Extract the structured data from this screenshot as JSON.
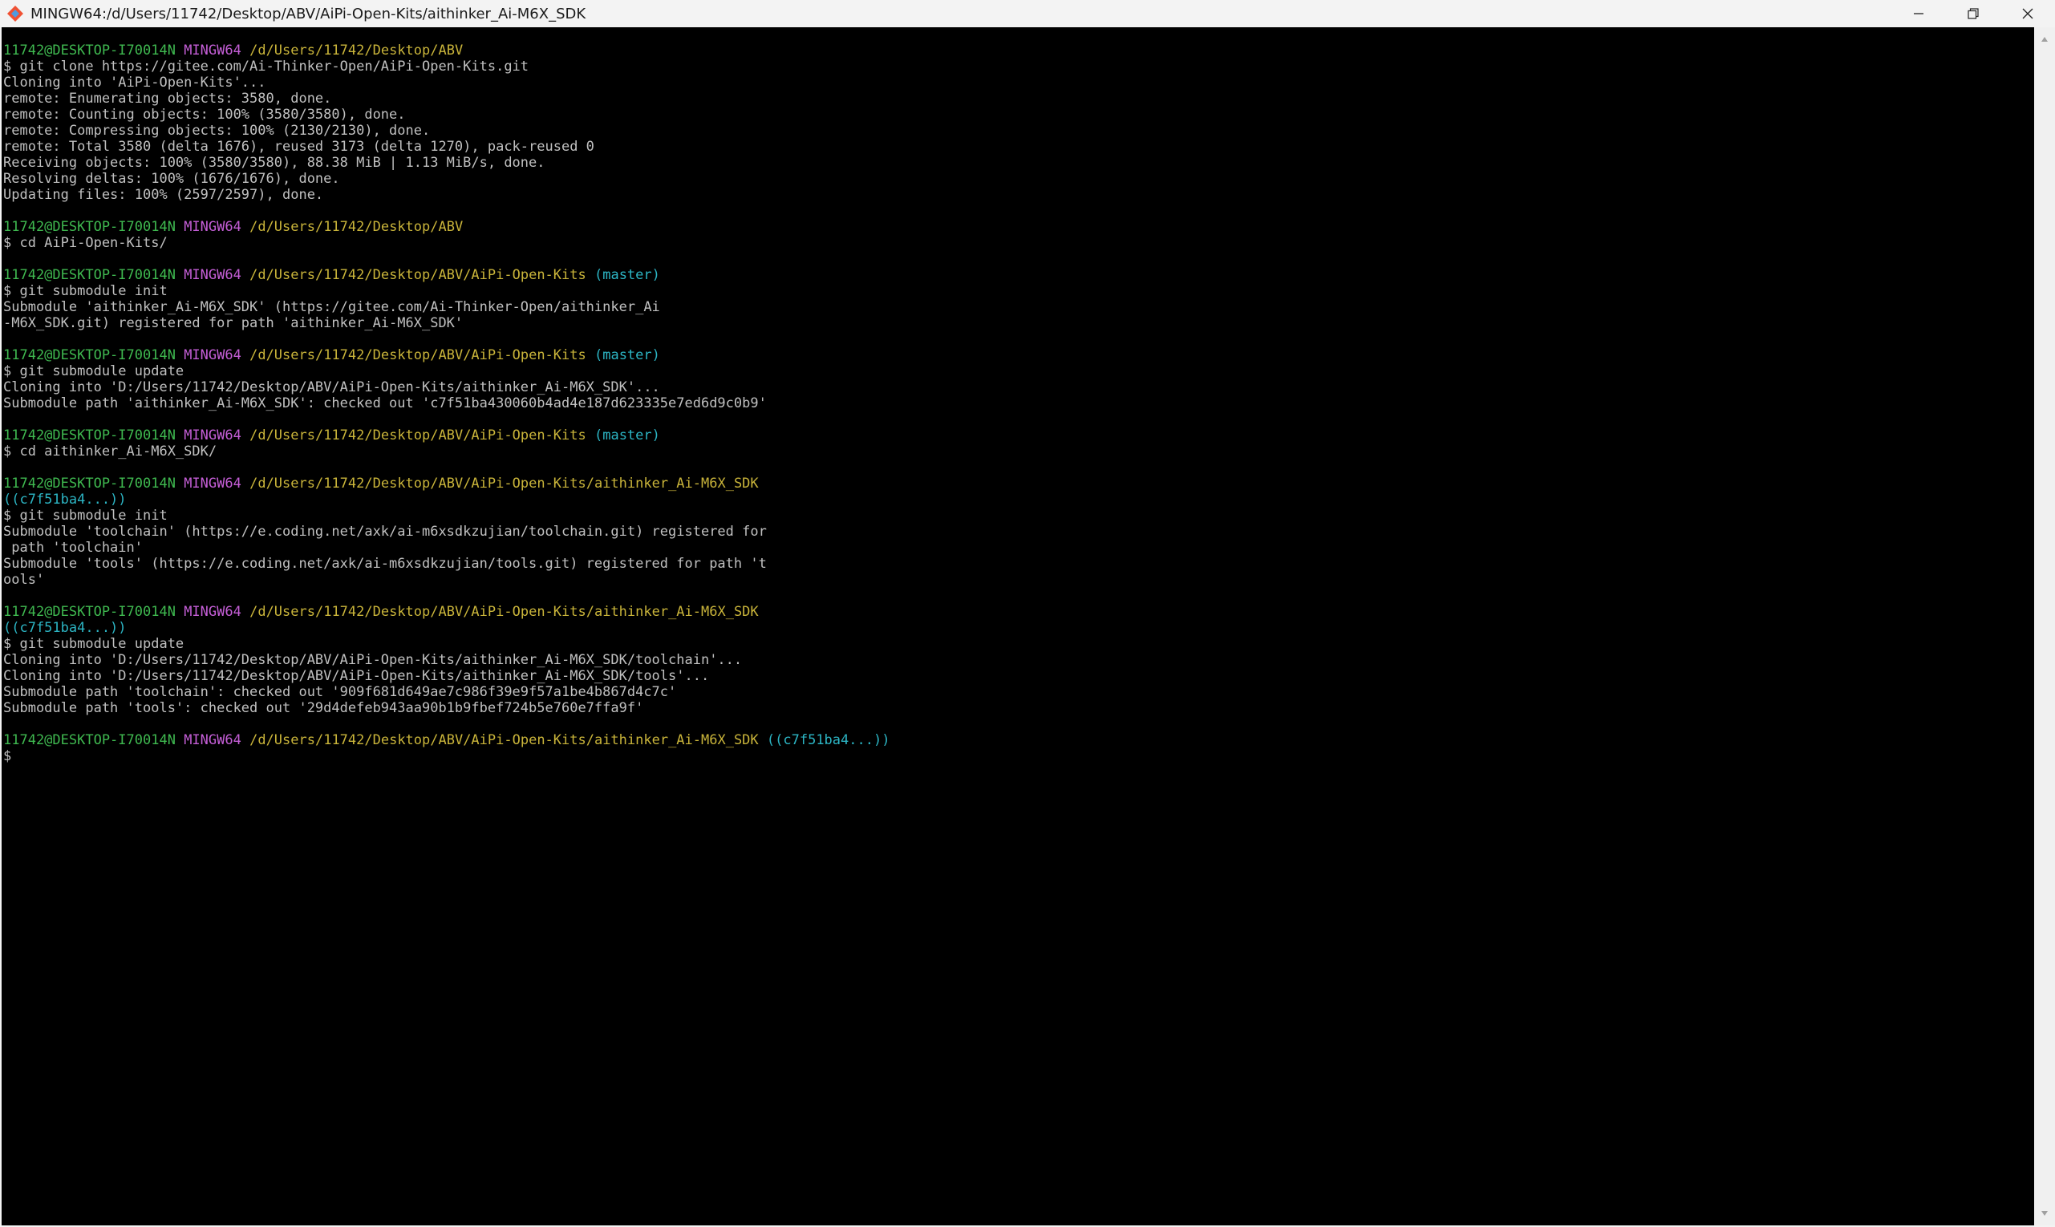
{
  "window": {
    "title": "MINGW64:/d/Users/11742/Desktop/ABV/AiPi-Open-Kits/aithinker_Ai-M6X_SDK"
  },
  "terminal": {
    "lines": [
      {
        "type": "prompt",
        "user": "11742@DESKTOP-I70014N",
        "sys": "MINGW64",
        "path": "/d/Users/11742/Desktop/ABV",
        "branch": ""
      },
      {
        "type": "text",
        "text": "$ git clone https://gitee.com/Ai-Thinker-Open/AiPi-Open-Kits.git"
      },
      {
        "type": "text",
        "text": "Cloning into 'AiPi-Open-Kits'..."
      },
      {
        "type": "text",
        "text": "remote: Enumerating objects: 3580, done."
      },
      {
        "type": "text",
        "text": "remote: Counting objects: 100% (3580/3580), done."
      },
      {
        "type": "text",
        "text": "remote: Compressing objects: 100% (2130/2130), done."
      },
      {
        "type": "text",
        "text": "remote: Total 3580 (delta 1676), reused 3173 (delta 1270), pack-reused 0"
      },
      {
        "type": "text",
        "text": "Receiving objects: 100% (3580/3580), 88.38 MiB | 1.13 MiB/s, done."
      },
      {
        "type": "text",
        "text": "Resolving deltas: 100% (1676/1676), done."
      },
      {
        "type": "text",
        "text": "Updating files: 100% (2597/2597), done."
      },
      {
        "type": "blank"
      },
      {
        "type": "prompt",
        "user": "11742@DESKTOP-I70014N",
        "sys": "MINGW64",
        "path": "/d/Users/11742/Desktop/ABV",
        "branch": ""
      },
      {
        "type": "text",
        "text": "$ cd AiPi-Open-Kits/"
      },
      {
        "type": "blank"
      },
      {
        "type": "prompt",
        "user": "11742@DESKTOP-I70014N",
        "sys": "MINGW64",
        "path": "/d/Users/11742/Desktop/ABV/AiPi-Open-Kits",
        "branch": "(master)"
      },
      {
        "type": "text",
        "text": "$ git submodule init"
      },
      {
        "type": "text",
        "text": "Submodule 'aithinker_Ai-M6X_SDK' (https://gitee.com/Ai-Thinker-Open/aithinker_Ai"
      },
      {
        "type": "text",
        "text": "-M6X_SDK.git) registered for path 'aithinker_Ai-M6X_SDK'"
      },
      {
        "type": "blank"
      },
      {
        "type": "prompt",
        "user": "11742@DESKTOP-I70014N",
        "sys": "MINGW64",
        "path": "/d/Users/11742/Desktop/ABV/AiPi-Open-Kits",
        "branch": "(master)"
      },
      {
        "type": "text",
        "text": "$ git submodule update"
      },
      {
        "type": "text",
        "text": "Cloning into 'D:/Users/11742/Desktop/ABV/AiPi-Open-Kits/aithinker_Ai-M6X_SDK'..."
      },
      {
        "type": "text",
        "text": "Submodule path 'aithinker_Ai-M6X_SDK': checked out 'c7f51ba430060b4ad4e187d623335e7ed6d9c0b9'"
      },
      {
        "type": "blank"
      },
      {
        "type": "prompt",
        "user": "11742@DESKTOP-I70014N",
        "sys": "MINGW64",
        "path": "/d/Users/11742/Desktop/ABV/AiPi-Open-Kits",
        "branch": "(master)"
      },
      {
        "type": "text",
        "text": "$ cd aithinker_Ai-M6X_SDK/"
      },
      {
        "type": "blank"
      },
      {
        "type": "prompt",
        "user": "11742@DESKTOP-I70014N",
        "sys": "MINGW64",
        "path": "/d/Users/11742/Desktop/ABV/AiPi-Open-Kits/aithinker_Ai-M6X_SDK",
        "branch": ""
      },
      {
        "type": "branchline",
        "text": "((c7f51ba4...))"
      },
      {
        "type": "text",
        "text": "$ git submodule init"
      },
      {
        "type": "text",
        "text": "Submodule 'toolchain' (https://e.coding.net/axk/ai-m6xsdkzujian/toolchain.git) registered for"
      },
      {
        "type": "text",
        "text": " path 'toolchain'"
      },
      {
        "type": "text",
        "text": "Submodule 'tools' (https://e.coding.net/axk/ai-m6xsdkzujian/tools.git) registered for path 't"
      },
      {
        "type": "text",
        "text": "ools'"
      },
      {
        "type": "blank"
      },
      {
        "type": "prompt",
        "user": "11742@DESKTOP-I70014N",
        "sys": "MINGW64",
        "path": "/d/Users/11742/Desktop/ABV/AiPi-Open-Kits/aithinker_Ai-M6X_SDK",
        "branch": ""
      },
      {
        "type": "branchline",
        "text": "((c7f51ba4...))"
      },
      {
        "type": "text",
        "text": "$ git submodule update"
      },
      {
        "type": "text",
        "text": "Cloning into 'D:/Users/11742/Desktop/ABV/AiPi-Open-Kits/aithinker_Ai-M6X_SDK/toolchain'..."
      },
      {
        "type": "text",
        "text": "Cloning into 'D:/Users/11742/Desktop/ABV/AiPi-Open-Kits/aithinker_Ai-M6X_SDK/tools'..."
      },
      {
        "type": "text",
        "text": "Submodule path 'toolchain': checked out '909f681d649ae7c986f39e9f57a1be4b867d4c7c'"
      },
      {
        "type": "text",
        "text": "Submodule path 'tools': checked out '29d4defeb943aa90b1b9fbef724b5e760e7ffa9f'"
      },
      {
        "type": "blank"
      },
      {
        "type": "prompt",
        "user": "11742@DESKTOP-I70014N",
        "sys": "MINGW64",
        "path": "/d/Users/11742/Desktop/ABV/AiPi-Open-Kits/aithinker_Ai-M6X_SDK",
        "branch": "((c7f51ba4...))"
      },
      {
        "type": "text",
        "text": "$"
      }
    ]
  },
  "icons": {
    "app": "git-bash-icon",
    "minimize": "minimize-icon",
    "maximize": "restore-icon",
    "close": "close-icon",
    "scroll_up": "scroll-up-arrow-icon",
    "scroll_down": "scroll-down-arrow-icon"
  },
  "colors": {
    "background": "#000000",
    "text": "#c0c0c0",
    "user": "#3fb950",
    "system": "#c45ed6",
    "path": "#c9b43a",
    "branch": "#2cb5c4"
  }
}
